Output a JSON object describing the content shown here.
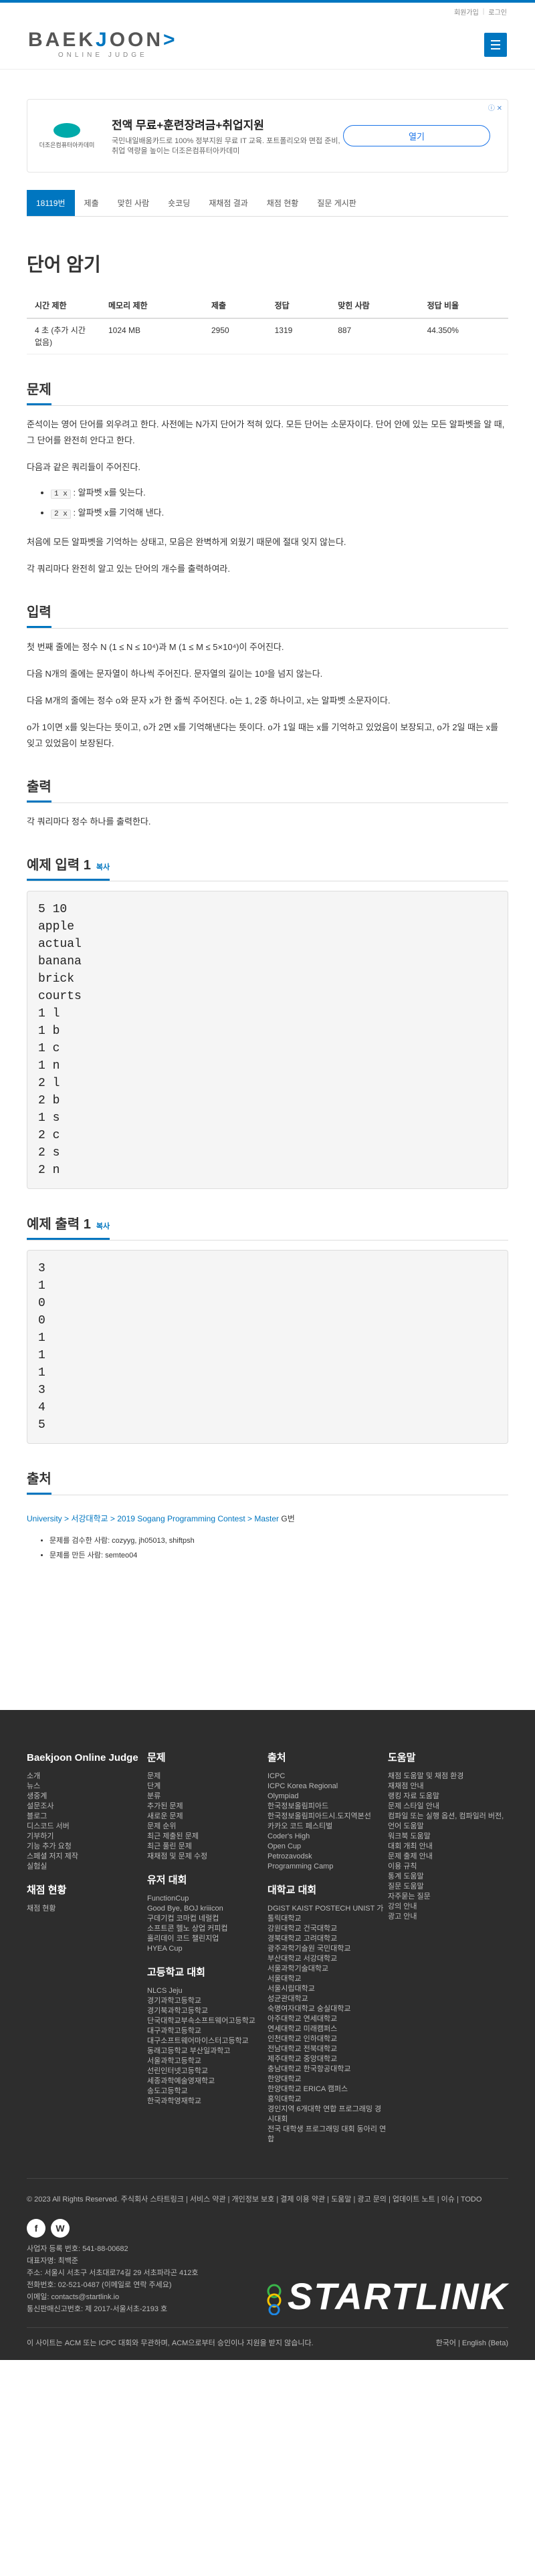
{
  "util": {
    "login": "회원가입",
    "logout": "로그인"
  },
  "logo": {
    "main_left": "BAEK",
    "main_acc": "J",
    "main_right": "OON",
    "arrow": ">",
    "sub": "ONLINE JUDGE"
  },
  "ad": {
    "brand": "더조은컴퓨터아카데미",
    "title": "전액 무료+훈련장려금+취업지원",
    "desc": "국민내일배움카드로 100% 정부지원 무료 IT 교육. 포트폴리오와 면접 준비, 취업 역량을 높이는 더조은컴퓨터아카데미",
    "open": "열기",
    "info": "ⓘ ✕"
  },
  "tabs": [
    "18119번",
    "제출",
    "맞힌 사람",
    "숏코딩",
    "재채점 결과",
    "채점 현황",
    "질문 게시판"
  ],
  "problem": {
    "title": "단어 암기",
    "headers": [
      "시간 제한",
      "메모리 제한",
      "제출",
      "정답",
      "맞힌 사람",
      "정답 비율"
    ],
    "row": [
      "4 초 (추가 시간 없음)",
      "1024 MB",
      "2950",
      "1319",
      "887",
      "44.350%"
    ]
  },
  "description": {
    "heading": "문제",
    "p1": "준석이는 영어 단어를 외우려고 한다. 사전에는 N가지 단어가 적혀 있다. 모든 단어는 소문자이다. 단어 안에 있는 모든 알파벳을 알 때, 그 단어를 완전히 안다고 한다.",
    "p2": "다음과 같은 쿼리들이 주어진다.",
    "q1_code": "1 x",
    "q1_text": ": 알파벳 x를 잊는다.",
    "q2_code": "2 x",
    "q2_text": ": 알파벳 x를 기억해 낸다.",
    "p3": "처음에 모든 알파벳을 기억하는 상태고, 모음은 완벽하게 외웠기 때문에 절대 잊지 않는다.",
    "p4": "각 쿼리마다 완전히 알고 있는 단어의 개수를 출력하여라."
  },
  "input": {
    "heading": "입력",
    "p1": "첫 번째 줄에는 정수 N (1 ≤ N ≤ 10⁴)과 M (1 ≤ M ≤ 5×10⁴)이 주어진다.",
    "p2": "다음 N개의 줄에는 문자열이 하나씩 주어진다. 문자열의 길이는 10³을 넘지 않는다.",
    "p3": "다음 M개의 줄에는 정수 o와 문자 x가 한 줄씩 주어진다. o는 1, 2중 하나이고, x는 알파벳 소문자이다.",
    "p4": "o가 1이면 x를 잊는다는 뜻이고, o가 2면 x를 기억해낸다는 뜻이다. o가 1일 때는 x를 기억하고 있었음이 보장되고, o가 2일 때는 x를 잊고 있었음이 보장된다."
  },
  "output": {
    "heading": "출력",
    "p1": "각 쿼리마다 정수 하나를 출력한다."
  },
  "sample_in": {
    "heading": "예제 입력 1",
    "copy": "복사",
    "text": "5 10\napple\nactual\nbanana\nbrick\ncourts\n1 l\n1 b\n1 c\n1 n\n2 l\n2 b\n1 s\n2 c\n2 s\n2 n"
  },
  "sample_out": {
    "heading": "예제 출력 1",
    "copy": "복사",
    "text": "3\n1\n0\n0\n1\n1\n1\n3\n4\n5"
  },
  "source": {
    "heading": "출처",
    "path": "University > 서강대학교 > 2019 Sogang Programming Contest > Master",
    "problem": "G번",
    "meta": [
      "문제를 검수한 사람: cozyyg, jh05013, shiftpsh",
      "문제를 만든 사람: semteo04"
    ]
  },
  "footer": {
    "col1": {
      "title": "Baekjoon Online Judge",
      "items": [
        "소개",
        "뉴스",
        "생중계",
        "설문조사",
        "블로그",
        "디스코드 서버",
        "기부하기",
        "기능 추가 요청",
        "스페셜 저지 제작",
        "실험실"
      ],
      "title2": "채점 현황",
      "items2": [
        "채점 현황"
      ]
    },
    "col2": {
      "title": "문제",
      "items": [
        "문제",
        "단계",
        "분류",
        "추가된 문제",
        "새로운 문제",
        "문제 순위",
        "최근 제출된 문제",
        "최근 풀린 문제",
        "재채점 및 문제 수정"
      ],
      "title2": "유저 대회",
      "items2": [
        "FunctionCup",
        "Good Bye, BOJ kriiicon",
        "구데기컵 코마컵 네럴컵",
        "소프트콘 헬노 상업 커피컵",
        "홀리데이 코드 챌린지업",
        "HYEA Cup"
      ],
      "title3": "고등학교 대회",
      "items3": [
        "NLCS Jeju",
        "경기과학고등학교",
        "경기북과학고등학교",
        "단국대학교부속소프트웨어고등학교",
        "대구과학고등학교",
        "대구소프트웨어마이스터고등학교",
        "동래고등학교 부산일과학고",
        "서울과학고등학교",
        "선린인터넷고등학교",
        "세종과학예술영재학교",
        "송도고등학교",
        "한국과학영재학교"
      ]
    },
    "col3": {
      "title": "출처",
      "items": [
        "ICPC",
        "ICPC Korea Regional",
        "Olympiad",
        "한국정보올림피아드",
        "한국정보올림피아드시.도지역본선",
        "카카오 코드 페스티벌",
        "Coder's High",
        "Open Cup",
        "Petrozavodsk",
        "Programming Camp"
      ],
      "title2": "대학교 대회",
      "items2": [
        "DGIST KAIST POSTECH UNIST 가톨릭대학교",
        "강원대학교 건국대학교",
        "경북대학교 고려대학교",
        "광주과학기술원 국민대학교",
        "부산대학교 서강대학교",
        "서울과학기술대학교",
        "서울대학교",
        "서울시립대학교",
        "성균관대학교",
        "숙명여자대학교 숭실대학교",
        "아주대학교 연세대학교",
        "연세대학교 미래캠퍼스",
        "인천대학교 인하대학교",
        "전남대학교 전북대학교",
        "제주대학교 중앙대학교",
        "충남대학교 한국항공대학교",
        "한양대학교",
        "한양대학교 ERICA 캠퍼스",
        "홍익대학교",
        "경인지역 6개대학 연합 프로그래밍 경시대회",
        "전국 대학생 프로그래밍 대회 동아리 연합"
      ]
    },
    "col4": {
      "title": "도움말",
      "items": [
        "채점 도움말 및 채점 환경",
        "재채점 안내",
        "랭킹 자료 도움말",
        "문제 스타일 안내",
        "컴파일 또는 실행 옵션, 컴파일러 버전, 언어 도움말",
        "워크북 도움말",
        "대회 개최 안내",
        "문제 출제 안내",
        "이용 규칙",
        "통계 도움말",
        "질문 도움말",
        "자주묻는 질문",
        "강의 안내",
        "광고 안내"
      ]
    },
    "copyright": "© 2023 All Rights Reserved. 주식회사 스타트링크 | 서비스 약관 | 개인정보 보호 | 결제 이용 약관 | 도움말 | 광고 문의 | 업데이트 노트 | 이슈 | TODO",
    "social": [
      "f",
      "W"
    ],
    "company": [
      "사업자 등록 번호: 541-88-00682",
      "대표자명: 최백준",
      "주소: 서울시 서초구 서초대로74길 29 서초파라곤 412호",
      "전화번호: 02-521-0487 (이메일로 연락 주세요)",
      "이메일: contacts@startlink.io",
      "통신판매신고번호: 제 2017-서울서초-2193 호"
    ],
    "startlink": "STARTLINK",
    "last_left": "이 사이트는 ACM 또는 ICPC 대회와 무관하며, ACM으로부터 승인이나 지원을 받지 않습니다.",
    "last_right": "한국어 | English (Beta)"
  }
}
